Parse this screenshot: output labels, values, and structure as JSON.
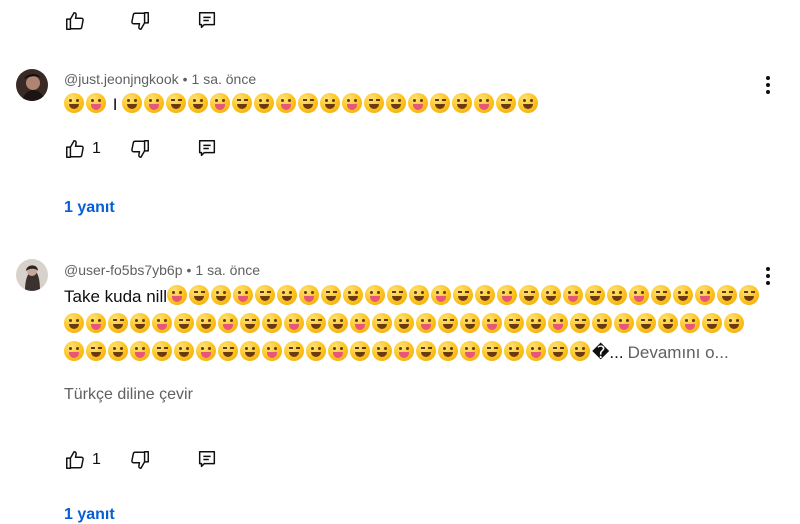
{
  "top_actions": {
    "like_count": ""
  },
  "comments": [
    {
      "author": "@just.jeonjngkook",
      "time": "1 sa. önce",
      "text_prefix": "",
      "emoji_count_before_sep": 2,
      "separator": "I",
      "emoji_count_after_sep": 19,
      "like_count": "1",
      "replies_label": "1 yanıt"
    },
    {
      "author": "@user-fo5bs7yb6p",
      "time": "1 sa. önce",
      "text_prefix": "Take kuda nill",
      "line1_emoji": 26,
      "line2_emoji": 31,
      "line3_emoji": 25,
      "trailing_char": "�...",
      "more_label": "Devamını o...",
      "translate_label": "Türkçe diline çevir",
      "like_count": "1",
      "replies_label": "1 yanıt"
    }
  ],
  "icons": {
    "like": "thumbs-up-icon",
    "dislike": "thumbs-down-icon",
    "reply": "reply-comment-icon",
    "menu": "more-vert-icon"
  }
}
